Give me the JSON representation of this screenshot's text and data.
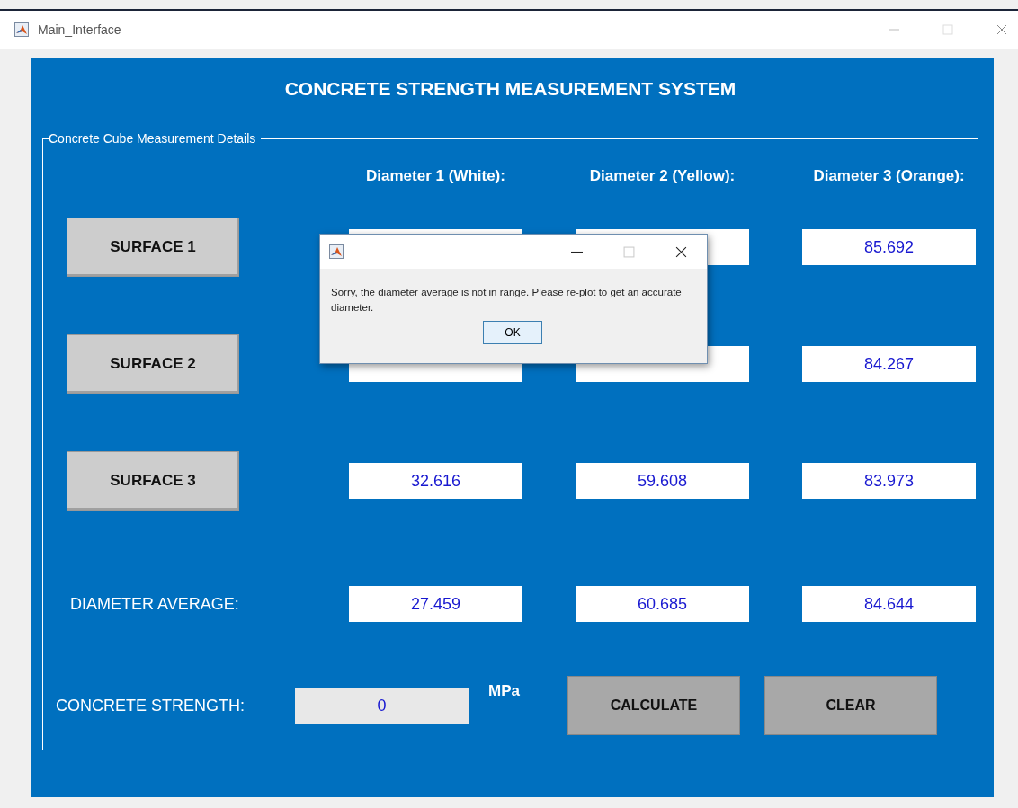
{
  "window": {
    "title": "Main_Interface"
  },
  "heading": "CONCRETE STRENGTH MEASUREMENT SYSTEM",
  "panel": {
    "title": "Concrete Cube Measurement Details"
  },
  "columns": [
    "Diameter 1 (White):",
    "Diameter 2 (Yellow):",
    "Diameter 3 (Orange):"
  ],
  "surfaces": [
    {
      "button": "SURFACE 1",
      "values": [
        "85.692"
      ]
    },
    {
      "button": "SURFACE 2",
      "values": [
        "84.267"
      ]
    },
    {
      "button": "SURFACE 3",
      "values": [
        "32.616",
        "59.608",
        "83.973"
      ]
    }
  ],
  "average": {
    "label": "DIAMETER AVERAGE:",
    "values": [
      "27.459",
      "60.685",
      "84.644"
    ]
  },
  "strength": {
    "label": "CONCRETE STRENGTH:",
    "value": "0",
    "unit": "MPa",
    "disabled": true
  },
  "buttons": [
    "CALCULATE",
    "CLEAR"
  ],
  "dialog": {
    "message": "Sorry, the diameter average is not in range. Please re-plot to get an accurate diameter.",
    "button": "OK"
  }
}
